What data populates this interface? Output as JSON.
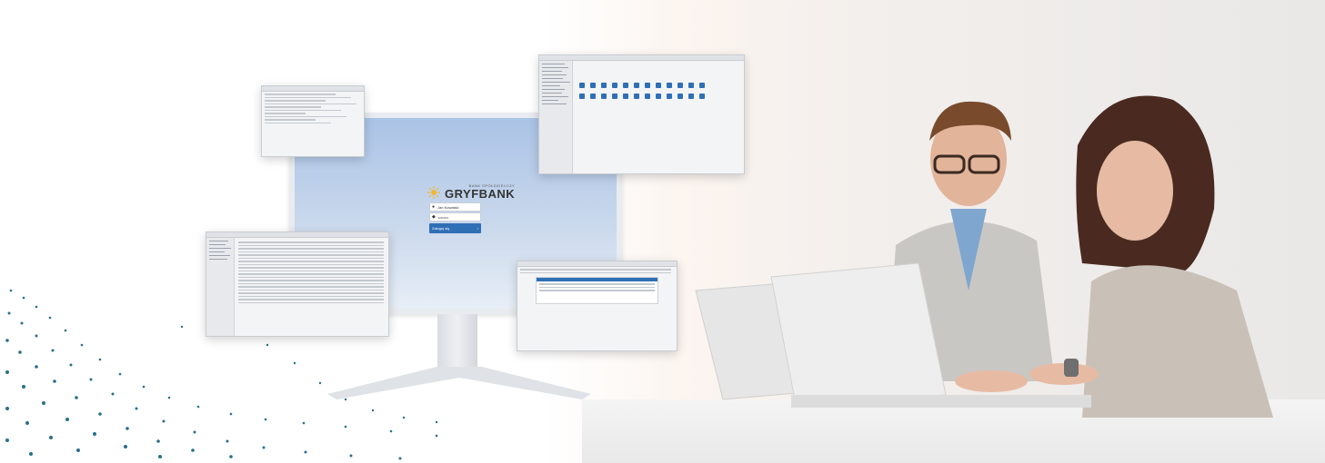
{
  "brand": {
    "logo_small": "BANK SPÓŁDZIELCZY",
    "logo_main": "GRYFBANK"
  },
  "login": {
    "username_value": "Jan Kowalski",
    "password_value": "••••••••",
    "submit_label": "Zaloguj się",
    "submit_arrow": "›"
  },
  "colors": {
    "accent": "#2f6fb6",
    "dots": "#2a6f8a"
  }
}
